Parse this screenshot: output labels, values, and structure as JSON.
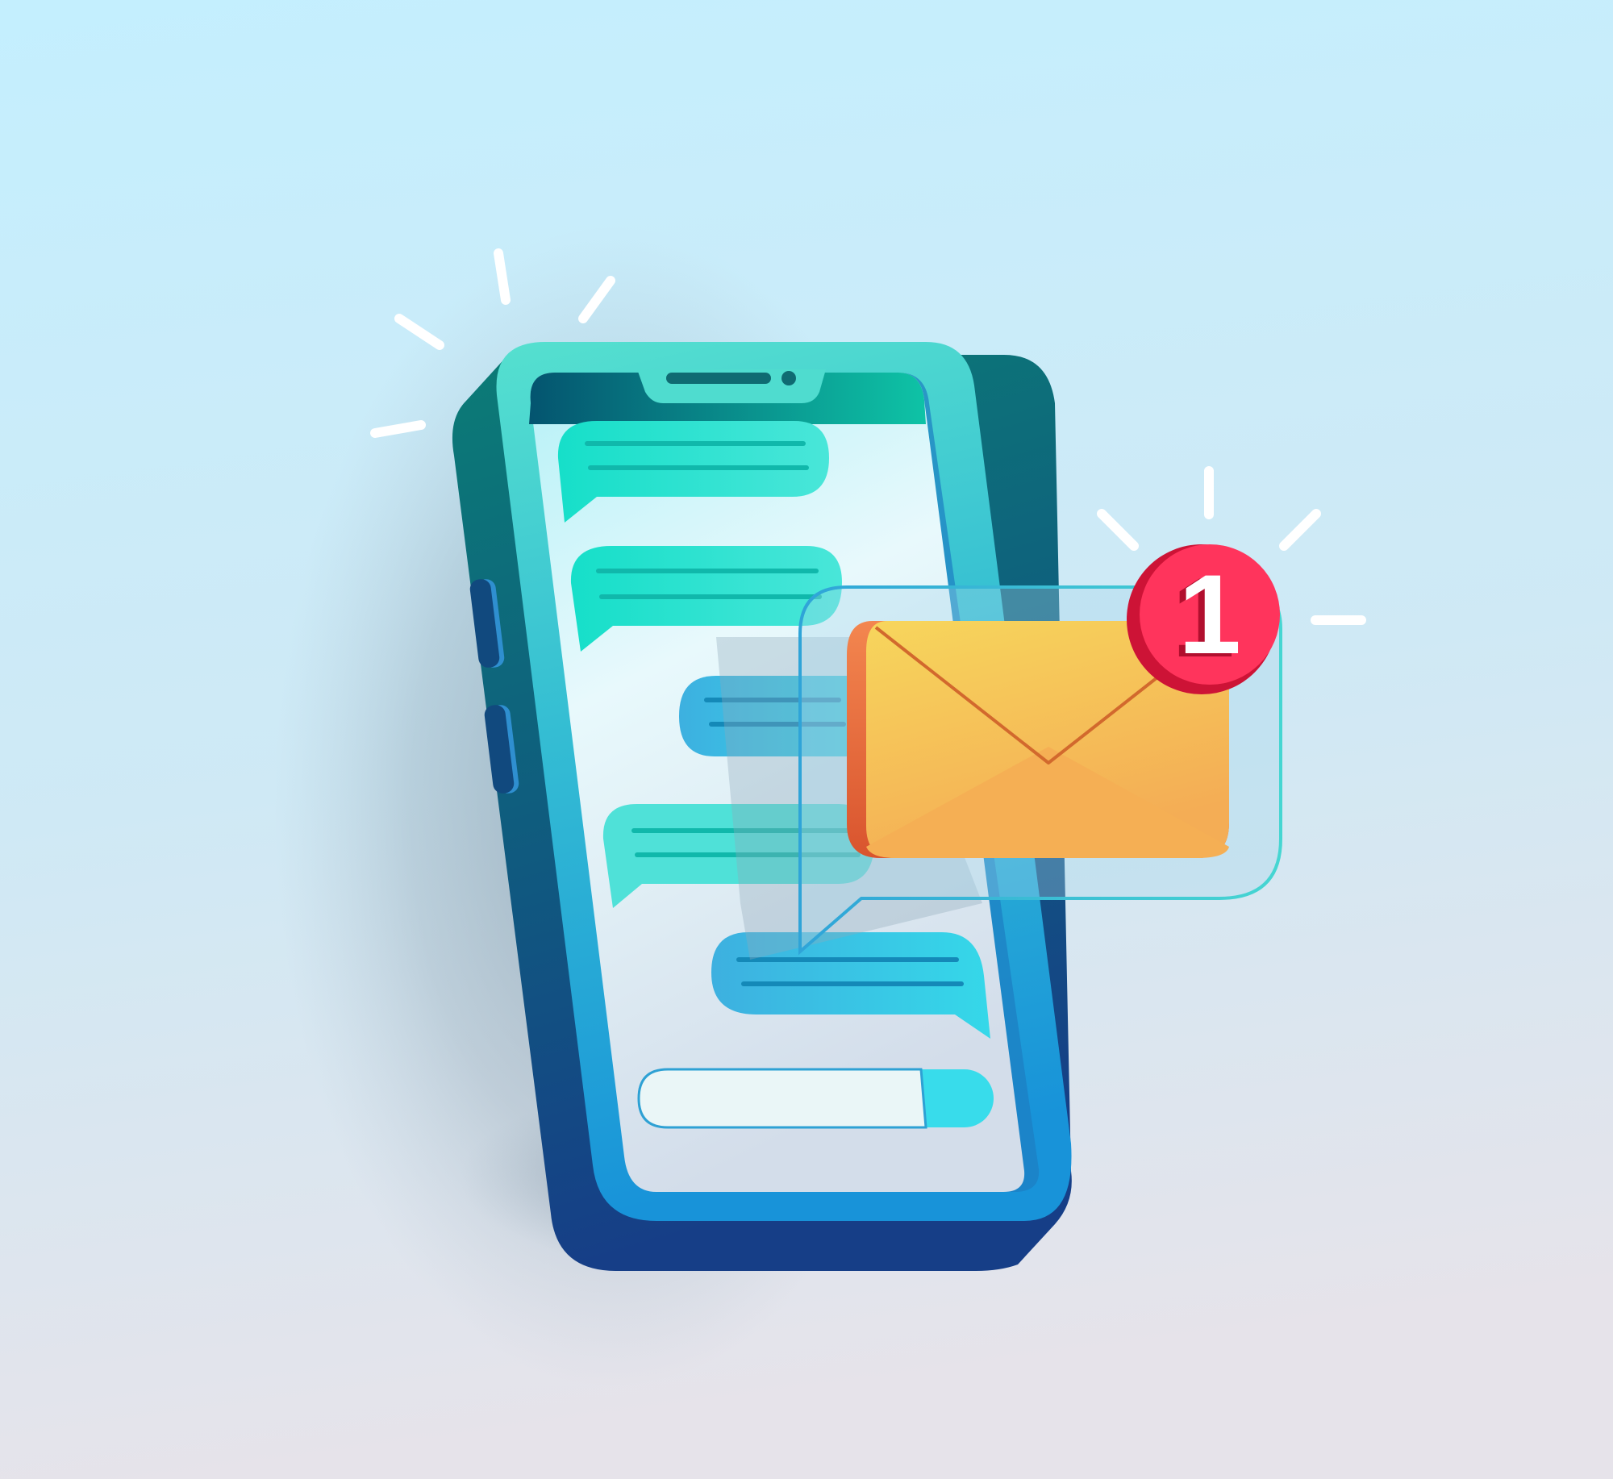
{
  "illustration": {
    "notification_badge": {
      "count": "1"
    },
    "icons": {
      "phone": "smartphone-icon",
      "envelope": "envelope-icon",
      "badge": "notification-badge",
      "bubbles": "chat-bubble-icon",
      "sparks": "alert-burst-icon"
    },
    "chat": {
      "incoming_bubbles": 3,
      "outgoing_bubbles": 2
    },
    "colors": {
      "background_top": "#c6effd",
      "background_bottom": "#e2e4ec",
      "phone_frame": "#4fdccf",
      "phone_body_top": "#0a7a78",
      "phone_body_bottom": "#153f86",
      "screen": "#e9f8fb",
      "incoming_bubble": "#2fe2d2",
      "outgoing_bubble": "#33c3e6",
      "envelope": "#f5c055",
      "envelope_flap": "#f4d258",
      "badge": "#ff345c",
      "spark": "#ffffff"
    }
  }
}
